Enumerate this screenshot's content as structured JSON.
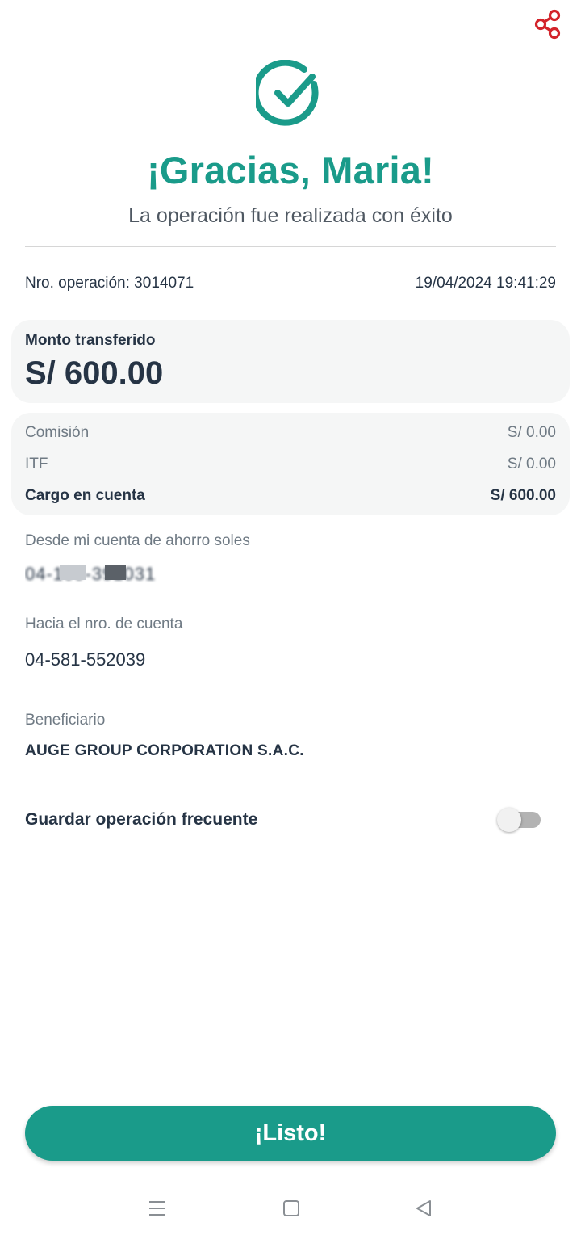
{
  "header": {
    "share_icon": "share-icon",
    "success_icon": "check-circle-icon"
  },
  "greeting": {
    "title": "¡Gracias, Maria!",
    "subtitle": "La operación fue realizada con éxito"
  },
  "operation": {
    "number_text": "Nro. operación: 3014071",
    "datetime": "19/04/2024 19:41:29"
  },
  "amount": {
    "label": "Monto transferido",
    "value": "S/ 600.00"
  },
  "fees": [
    {
      "label": "Comisión",
      "value": "S/ 0.00"
    },
    {
      "label": "ITF",
      "value": "S/ 0.00"
    },
    {
      "label": "Cargo en cuenta",
      "value": "S/ 600.00"
    }
  ],
  "source_account": {
    "label": "Desde mi cuenta de ahorro soles",
    "value": "04-109-391031"
  },
  "destination_account": {
    "label": "Hacia el nro. de cuenta",
    "value": "04-581-552039"
  },
  "beneficiary": {
    "label": "Beneficiario",
    "value": "AUGE GROUP CORPORATION S.A.C."
  },
  "save_frequent": {
    "label": "Guardar operación frecuente",
    "enabled": false
  },
  "actions": {
    "done_label": "¡Listo!"
  },
  "system_nav": {
    "menu_icon": "menu-icon",
    "home_icon": "home-square-icon",
    "back_icon": "back-triangle-icon"
  },
  "colors": {
    "accent": "#1a9b8a",
    "share": "#d3232a",
    "text_dark": "#263445",
    "text_muted": "#6f7a84",
    "card_bg": "#f5f6f6"
  }
}
